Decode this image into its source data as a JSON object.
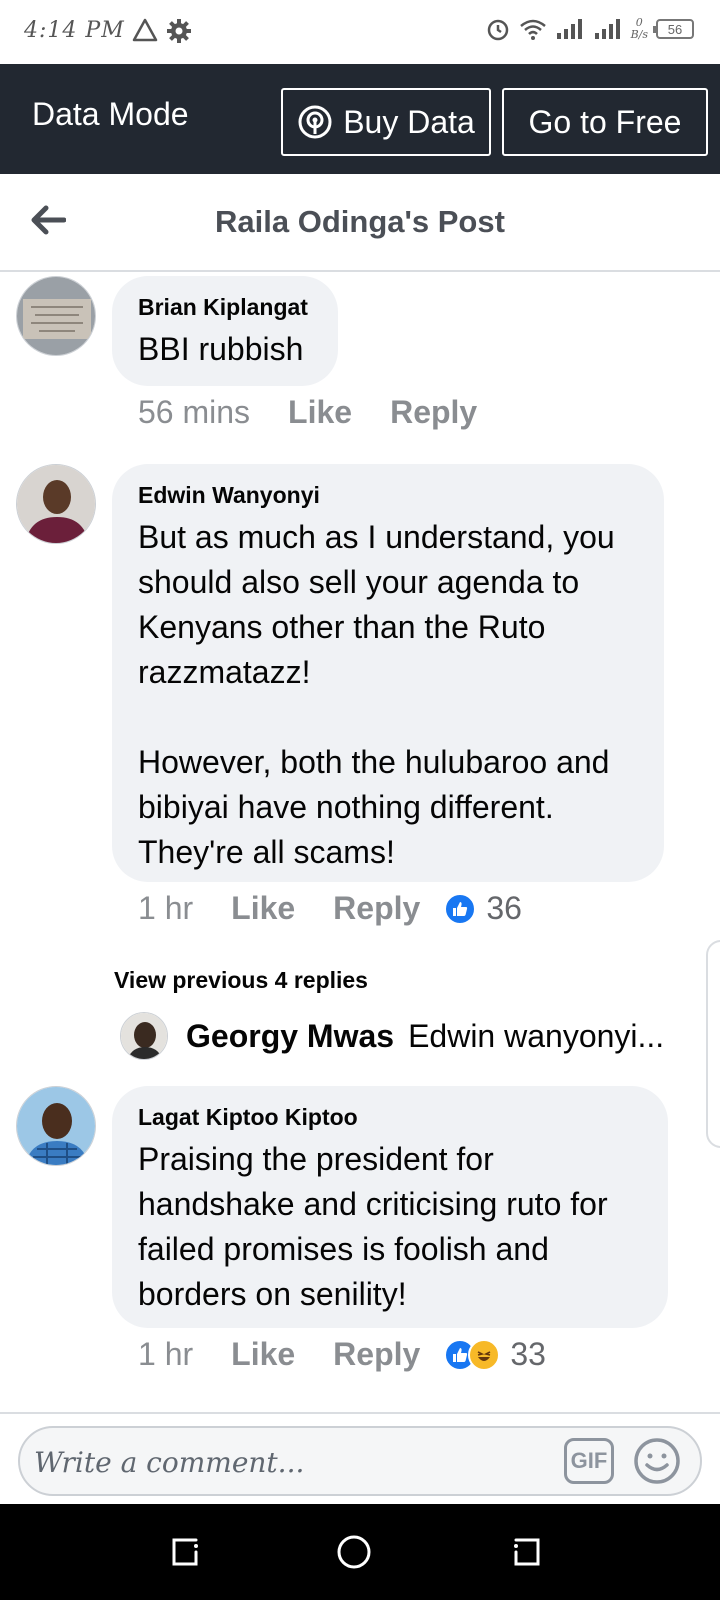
{
  "status_bar": {
    "time": "4:14 PM",
    "data_indicator_top": "0",
    "data_indicator_bottom": "B/s",
    "battery": "56",
    "icons": [
      "warning-icon",
      "gear-icon",
      "alarm-icon",
      "wifi-icon",
      "signal-icon",
      "signal-icon"
    ]
  },
  "data_mode": {
    "label": "Data Mode",
    "buy_button": "Buy Data",
    "free_button": "Go to Free"
  },
  "header": {
    "title": "Raila Odinga's Post",
    "back_icon": "arrow-left-icon"
  },
  "comments": [
    {
      "author": "Brian Kiplangat",
      "text": "BBI rubbish",
      "time": "56 mins",
      "like": "Like",
      "reply": "Reply"
    },
    {
      "author": "Edwin Wanyonyi",
      "text": "But as much as I understand, you should also sell your agenda to Kenyans other than the Ruto razzmatazz!\n\nHowever, both the hulubaroo and bibiyai have nothing different. They're all scams!",
      "time": "1 hr",
      "like": "Like",
      "reply": "Reply",
      "reaction_count": "36"
    },
    {
      "author": "Lagat Kiptoo Kiptoo",
      "text": "Praising the president for handshake and criticising ruto for failed promises is foolish and borders on senility!",
      "time": "1 hr",
      "like": "Like",
      "reply": "Reply",
      "reaction_count": "33"
    }
  ],
  "replies_section": {
    "view_previous": "View previous 4 replies",
    "reply_author": "Georgy Mwas",
    "reply_snippet": "Edwin wanyonyi..."
  },
  "composer": {
    "placeholder": "Write a comment...",
    "gif_label": "GIF"
  },
  "colors": {
    "data_bar": "#222831",
    "bubble": "#f0f2f5",
    "meta_text": "#8a8d91",
    "like_blue": "#1877f2"
  }
}
